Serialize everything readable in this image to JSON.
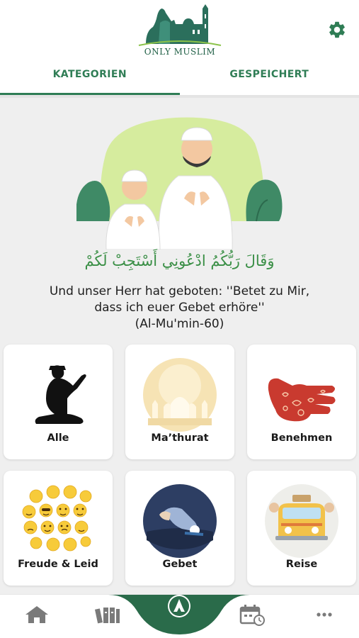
{
  "app": {
    "logo_text": "ONLY MUSLIM"
  },
  "tabs": [
    {
      "label": "KATEGORIEN",
      "active": true
    },
    {
      "label": "GESPEICHERT",
      "active": false
    }
  ],
  "hero": {
    "arabic": "وَقَالَ رَبُّكُمُ ادْعُونِي أَسْتَجِبْ لَكُمْ",
    "translation_line1": "Und unser Herr hat geboten: ''Betet zu Mir,",
    "translation_line2": "dass ich euer Gebet erhöre''",
    "reference": "(Al-Mu'min-60)"
  },
  "categories": [
    {
      "label": "Alle",
      "icon": "praying-man-silhouette-icon"
    },
    {
      "label": "Ma’thurat",
      "icon": "mosque-icon"
    },
    {
      "label": "Benehmen",
      "icon": "henna-hand-icon"
    },
    {
      "label": "Freude & Leid",
      "icon": "emoji-faces-icon"
    },
    {
      "label": "Gebet",
      "icon": "prostration-icon"
    },
    {
      "label": "Reise",
      "icon": "travel-van-icon"
    }
  ],
  "bottom_nav": [
    {
      "name": "home",
      "icon": "home-icon"
    },
    {
      "name": "books",
      "icon": "books-icon"
    },
    {
      "name": "dua",
      "icon": "praying-hands-icon",
      "active": true
    },
    {
      "name": "calendar",
      "icon": "calendar-clock-icon"
    },
    {
      "name": "more",
      "icon": "more-dots-icon"
    }
  ],
  "colors": {
    "primary": "#2f7d55",
    "dark_green": "#1f5f45",
    "arabic_green": "#3a8f46",
    "background": "#efefef"
  }
}
